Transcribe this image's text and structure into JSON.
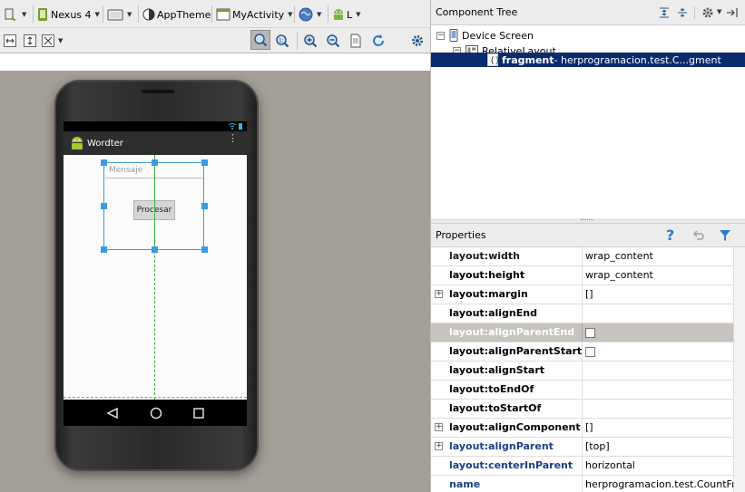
{
  "toolbar": {
    "device": "Nexus 4",
    "theme": "AppTheme",
    "activity": "MyActivity",
    "api": "L"
  },
  "app": {
    "title": "Wordter",
    "edit_hint": "Mensaje",
    "button_label": "Procesar"
  },
  "component_tree": {
    "title": "Component Tree",
    "nodes": [
      {
        "label": "Device Screen"
      },
      {
        "label": "RelativeLayout"
      },
      {
        "label": "fragment",
        "detail": " - herprogramacion.test.C...gment"
      }
    ]
  },
  "properties": {
    "title": "Properties",
    "rows": [
      {
        "name": "layout:width",
        "value": "wrap_content"
      },
      {
        "name": "layout:height",
        "value": "wrap_content"
      },
      {
        "name": "layout:margin",
        "value": "[]"
      },
      {
        "name": "layout:alignEnd",
        "value": ""
      },
      {
        "name": "layout:alignParentEnd",
        "value": ""
      },
      {
        "name": "layout:alignParentStart",
        "value": ""
      },
      {
        "name": "layout:alignStart",
        "value": ""
      },
      {
        "name": "layout:toEndOf",
        "value": ""
      },
      {
        "name": "layout:toStartOf",
        "value": ""
      },
      {
        "name": "layout:alignComponent",
        "value": "[]"
      },
      {
        "name": "layout:alignParent",
        "value": "[top]"
      },
      {
        "name": "layout:centerInParent",
        "value": "horizontal"
      },
      {
        "name": "name",
        "value": "herprogramacion.test.CountFr..."
      }
    ]
  },
  "colors": {
    "selection": "#0a2b6e",
    "link_blue": "#1a3f8a",
    "guide_green": "#3cb23c",
    "handle_blue": "#3c9be0"
  }
}
